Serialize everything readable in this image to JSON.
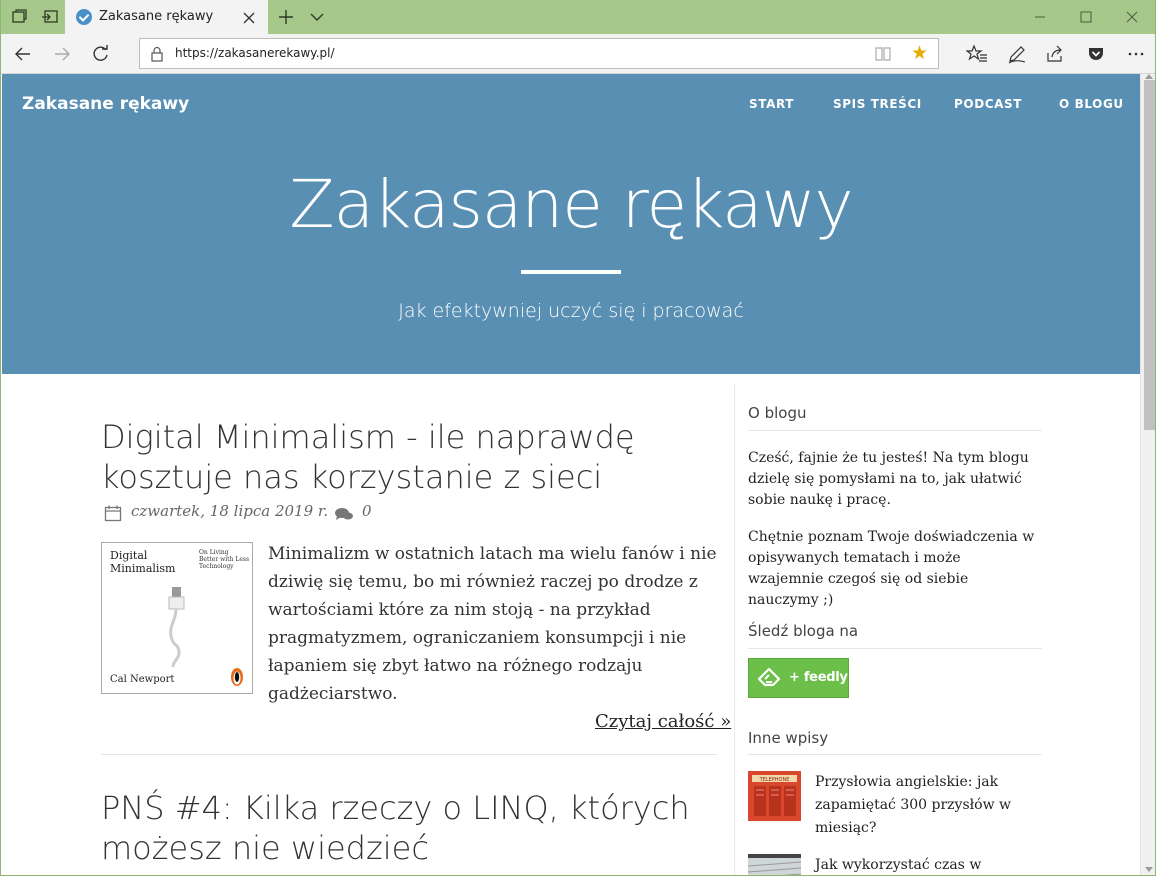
{
  "browser": {
    "tab_title": "Zakasane rękawy",
    "url": "https://zakasanerekawy.pl/",
    "accent_color": "#a6c98b"
  },
  "site": {
    "brand": "Zakasane rękawy",
    "menu": [
      "START",
      "SPIS TREŚCI",
      "PODCAST",
      "O BLOGU"
    ],
    "hero_title": "Zakasane rękawy",
    "hero_subtitle": "Jak efektywniej uczyć się i pracować",
    "hero_color": "#588fb3"
  },
  "posts": [
    {
      "title_line1": "Digital Minimalism - ile naprawdę",
      "title_line2": "kosztuje nas korzystanie z sieci",
      "date": "czwartek, 18 lipca 2019 r.",
      "comments": "0",
      "cover": {
        "title_line1": "Digital",
        "title_line2": "Minimalism",
        "subtitle_line1": "On Living",
        "subtitle_line2": "Better with Less",
        "subtitle_line3": "Technology",
        "author": "Cal Newport"
      },
      "excerpt": "Minimalizm w ostatnich latach ma wielu fanów i nie dziwię się temu, bo mi również raczej po drodze z wartościami które za nim stoją - na przykład pragmatyzmem, ograniczaniem konsumpcji i nie łapaniem się zbyt łatwo na różnego rodzaju gadżeciarstwo.",
      "read_more": "Czytaj całość »"
    },
    {
      "title_line1": "PNŚ #4: Kilka rzeczy o LINQ, których",
      "title_line2": "możesz nie wiedzieć"
    }
  ],
  "sidebar": {
    "about_title": "O blogu",
    "about_p1": "Cześć, fajnie że tu jesteś! Na tym blogu dzielę się pomysłami na to, jak ułatwić sobie naukę i pracę.",
    "about_p2": "Chętnie poznam Twoje doświadczenia w opisywanych tematach i może wzajemnie czegoś się od siebie nauczymy ;)",
    "follow_title": "Śledź bloga na",
    "feedly_label": "+ feedly",
    "other_title": "Inne wpisy",
    "other_posts": [
      {
        "title": "Przysłowia angielskie: jak zapamiętać 300 przysłów w miesiąc?",
        "thumb_label": "TELEPHONE"
      },
      {
        "title": "Jak wykorzystać czas w"
      }
    ]
  }
}
